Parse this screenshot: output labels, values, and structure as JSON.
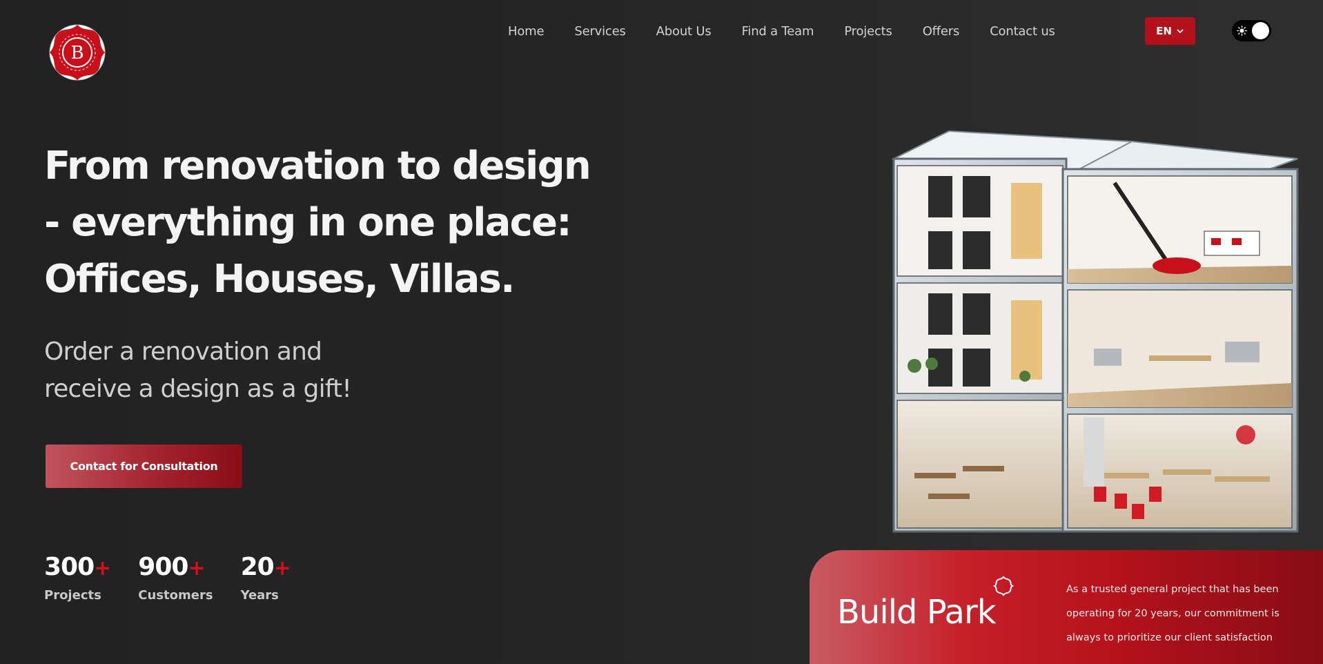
{
  "logo": {
    "letter": "B"
  },
  "nav": {
    "items": [
      "Home",
      "Services",
      "About Us",
      "Find a Team",
      "Projects",
      "Offers",
      "Contact us"
    ]
  },
  "language": {
    "selected": "EN"
  },
  "theme_toggle": {
    "icon": "sun-icon",
    "state": "light"
  },
  "hero": {
    "headline_lines": [
      "From renovation to design",
      "- everything in one place:",
      "Offices, Houses, Villas."
    ],
    "subhead_lines": [
      "Order a renovation and",
      "receive a design as a gift!"
    ],
    "cta_label": "Contact for Consultation"
  },
  "stats": [
    {
      "value": "300",
      "suffix": "+",
      "label": "Projects"
    },
    {
      "value": "900",
      "suffix": "+",
      "label": "Customers"
    },
    {
      "value": "20",
      "suffix": "+",
      "label": "Years"
    }
  ],
  "banner": {
    "title": "Build Park",
    "icon": "flower-outline-icon",
    "text": "As a trusted general project that has been operating for 20 years, our commitment is always to prioritize our client satisfaction"
  },
  "colors": {
    "accent": "#b3121c",
    "background": "#242424",
    "banner_start": "#c95b64",
    "banner_end": "#880c14"
  }
}
